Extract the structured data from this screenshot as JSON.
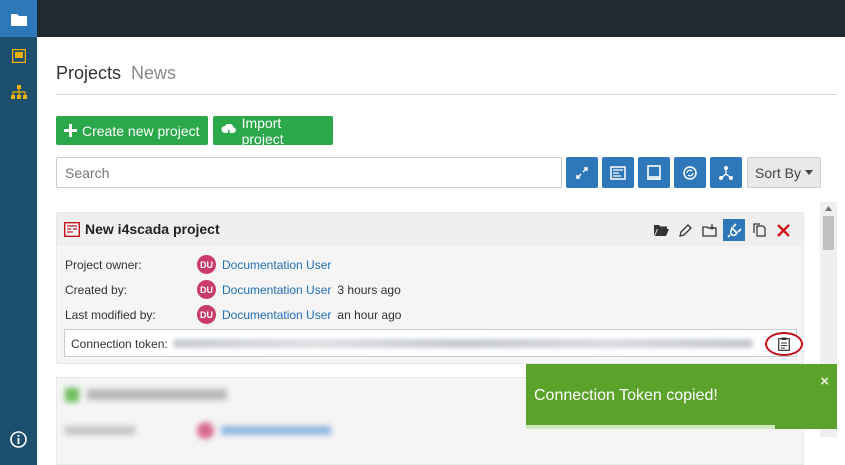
{
  "tabs": {
    "projects": "Projects",
    "news": "News"
  },
  "buttons": {
    "create": "Create new project",
    "import": "Import project",
    "sort": "Sort By"
  },
  "search": {
    "placeholder": "Search"
  },
  "project": {
    "title": "New i4scada project",
    "owner_label": "Project owner:",
    "created_label": "Created by:",
    "modified_label": "Last modified by:",
    "avatar_initials": "DU",
    "user_name": "Documentation User",
    "created_ago": "3 hours ago",
    "modified_ago": "an hour ago",
    "token_label": "Connection token:"
  },
  "toast": {
    "message": "Connection Token copied!",
    "close": "×",
    "progress": 0.8
  },
  "colors": {
    "sidebar": "#1c4e6e",
    "topbar": "#1f2a33",
    "primary": "#2e77b8",
    "success": "#2aa84a",
    "toast": "#5aa229",
    "danger": "#c0101a"
  },
  "icons": {
    "sidebar": [
      "projects-icon",
      "dashboard-icon",
      "hierarchy-icon",
      "info-icon"
    ],
    "toolbar": [
      "filter-connected-icon",
      "filter-template-icon",
      "filter-device-icon",
      "filter-refresh-icon",
      "filter-network-icon"
    ],
    "card": [
      "open-folder-icon",
      "edit-icon",
      "export-icon",
      "plug-icon",
      "copy-icon",
      "delete-icon"
    ]
  }
}
